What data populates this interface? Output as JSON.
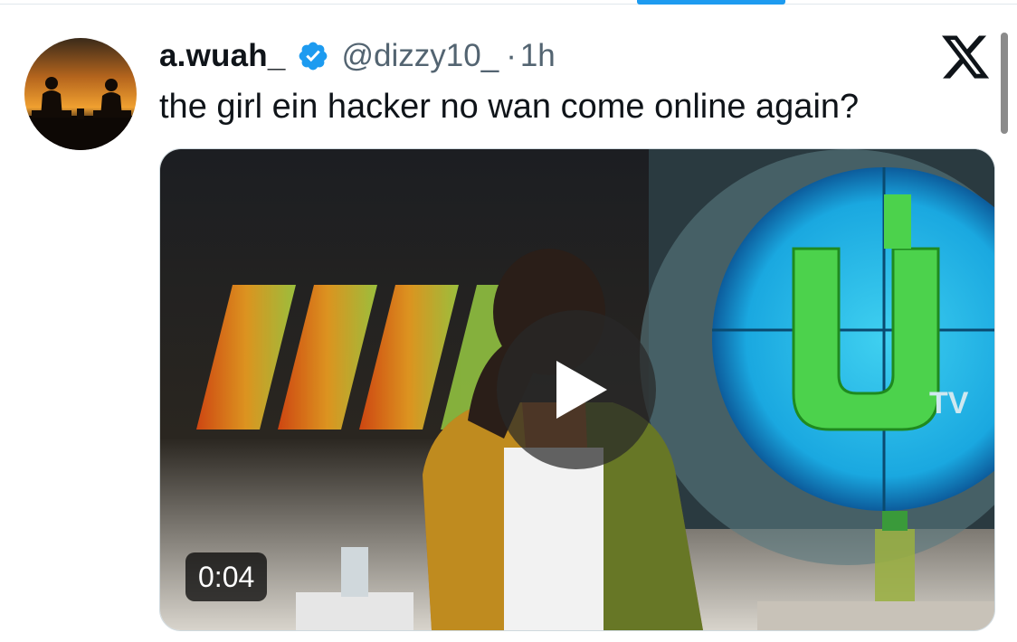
{
  "tweet": {
    "display_name": "a.wuah_",
    "handle": "@dizzy10_",
    "separator": "·",
    "timestamp": "1h",
    "text": "the girl ein hacker no wan come online again?",
    "verified": true,
    "avatar": "sunset-silhouette-avatar",
    "platform_logo": "x-logo"
  },
  "media": {
    "type": "video",
    "duration": "0:04",
    "play_icon": "play-icon",
    "channel_watermark": "UTV"
  },
  "colors": {
    "verified_blue": "#1d9bf0",
    "secondary_text": "#536471",
    "accent": "#1d9bf0"
  }
}
